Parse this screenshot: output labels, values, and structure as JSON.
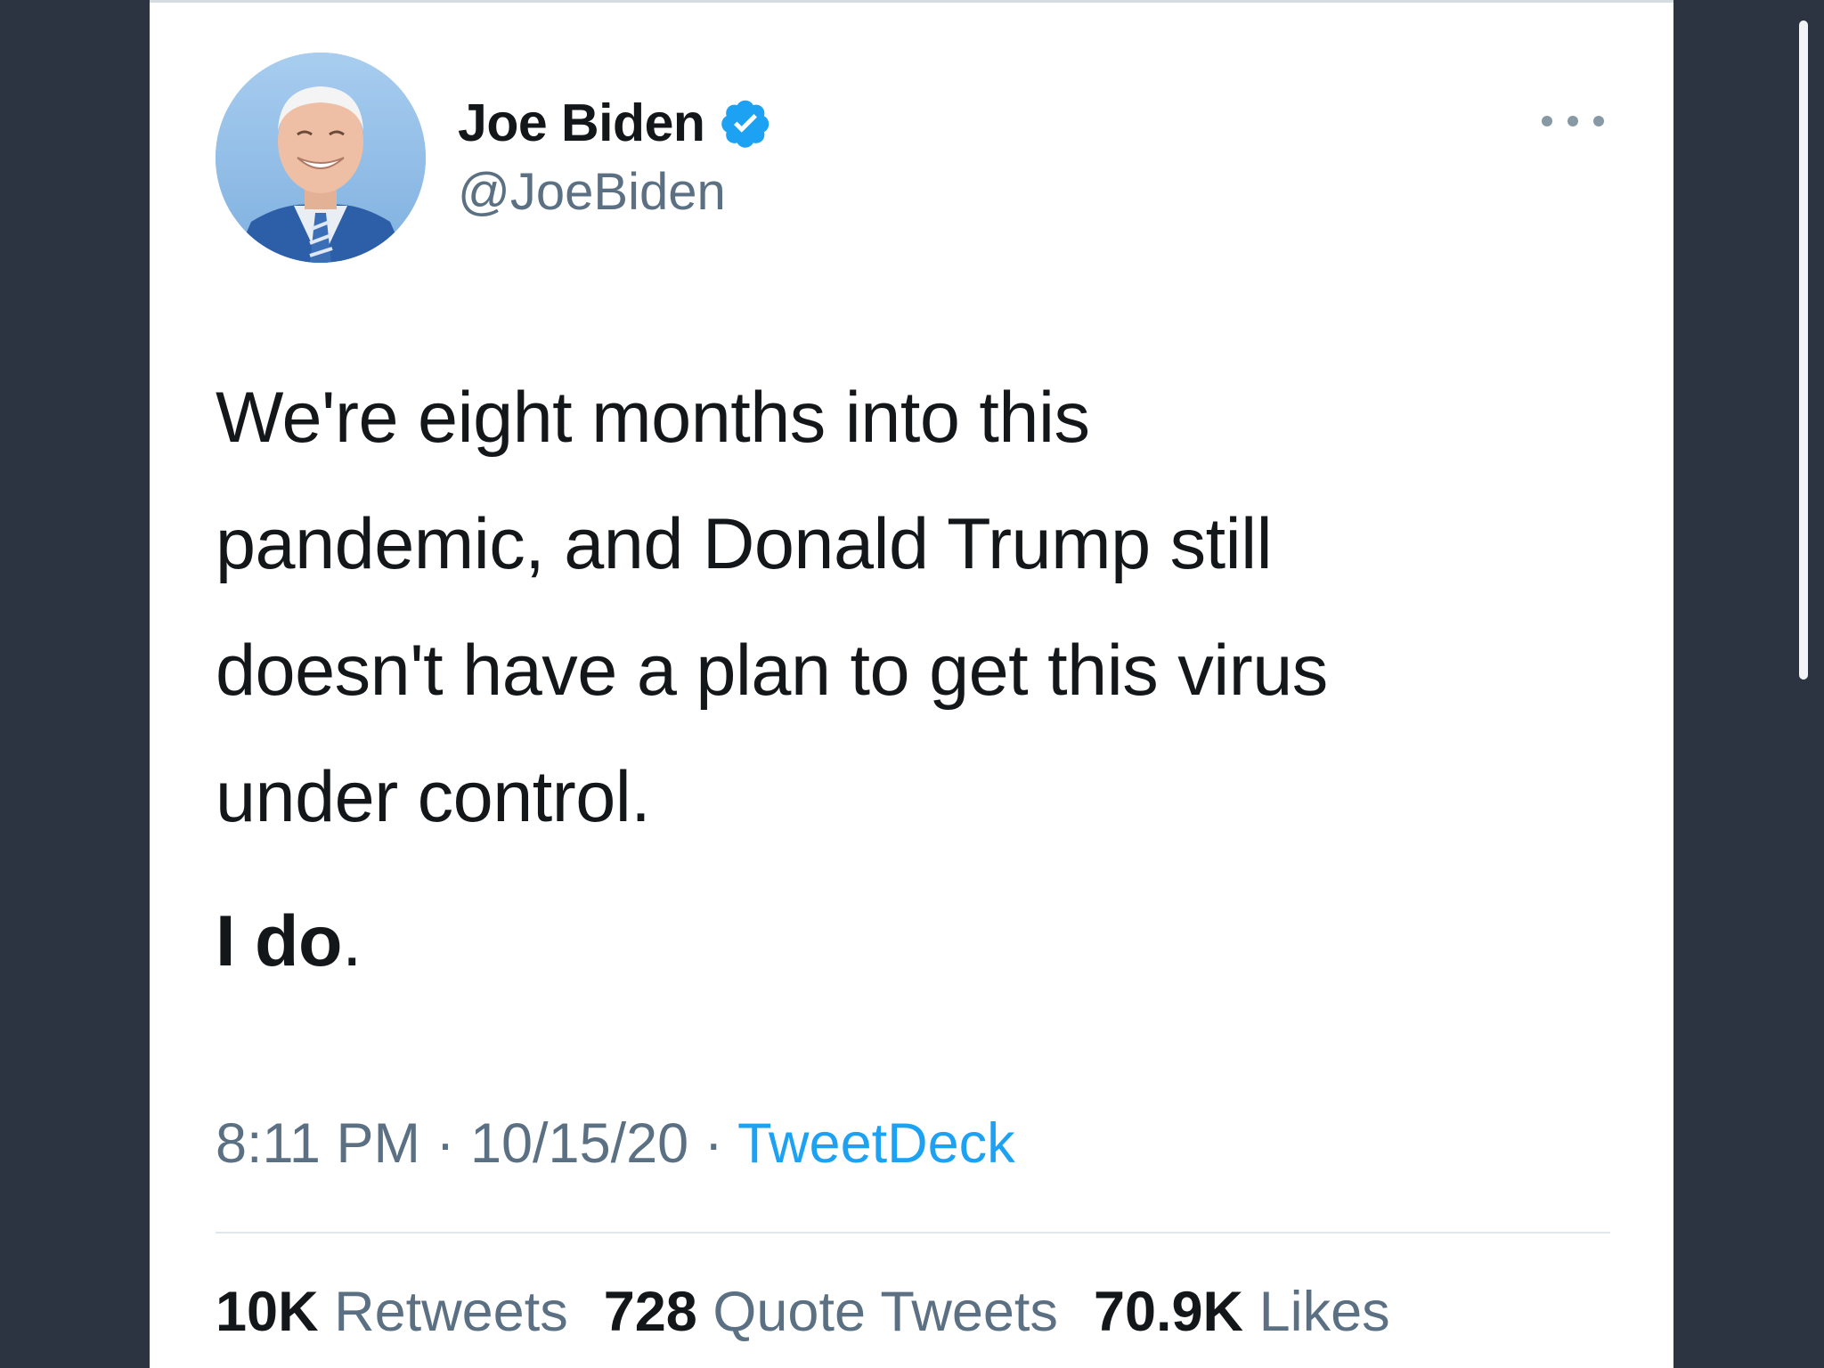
{
  "tweet": {
    "author": {
      "display_name": "Joe Biden",
      "handle": "@JoeBiden",
      "verified": true
    },
    "text_lines": [
      "We're eight months into this",
      "pandemic, and Donald Trump still",
      "doesn't have a plan to get this virus",
      "under control."
    ],
    "emphasis": {
      "bold": "I do",
      "trail": "."
    },
    "meta": {
      "time": "8:11 PM",
      "sep1": " · ",
      "date": "10/15/20",
      "sep2": " · ",
      "source": "TweetDeck"
    },
    "stats": {
      "retweets_count": "10K",
      "retweets_label": "Retweets",
      "quotes_count": "728",
      "quotes_label": "Quote Tweets",
      "likes_count": "70.9K",
      "likes_label": "Likes"
    }
  },
  "icons": {
    "verified": "verified-badge-icon",
    "more": "more-options-icon"
  },
  "colors": {
    "background": "#2b3440",
    "card": "#ffffff",
    "text": "#14171a",
    "secondary": "#5b7083",
    "accent": "#1da1f2"
  }
}
